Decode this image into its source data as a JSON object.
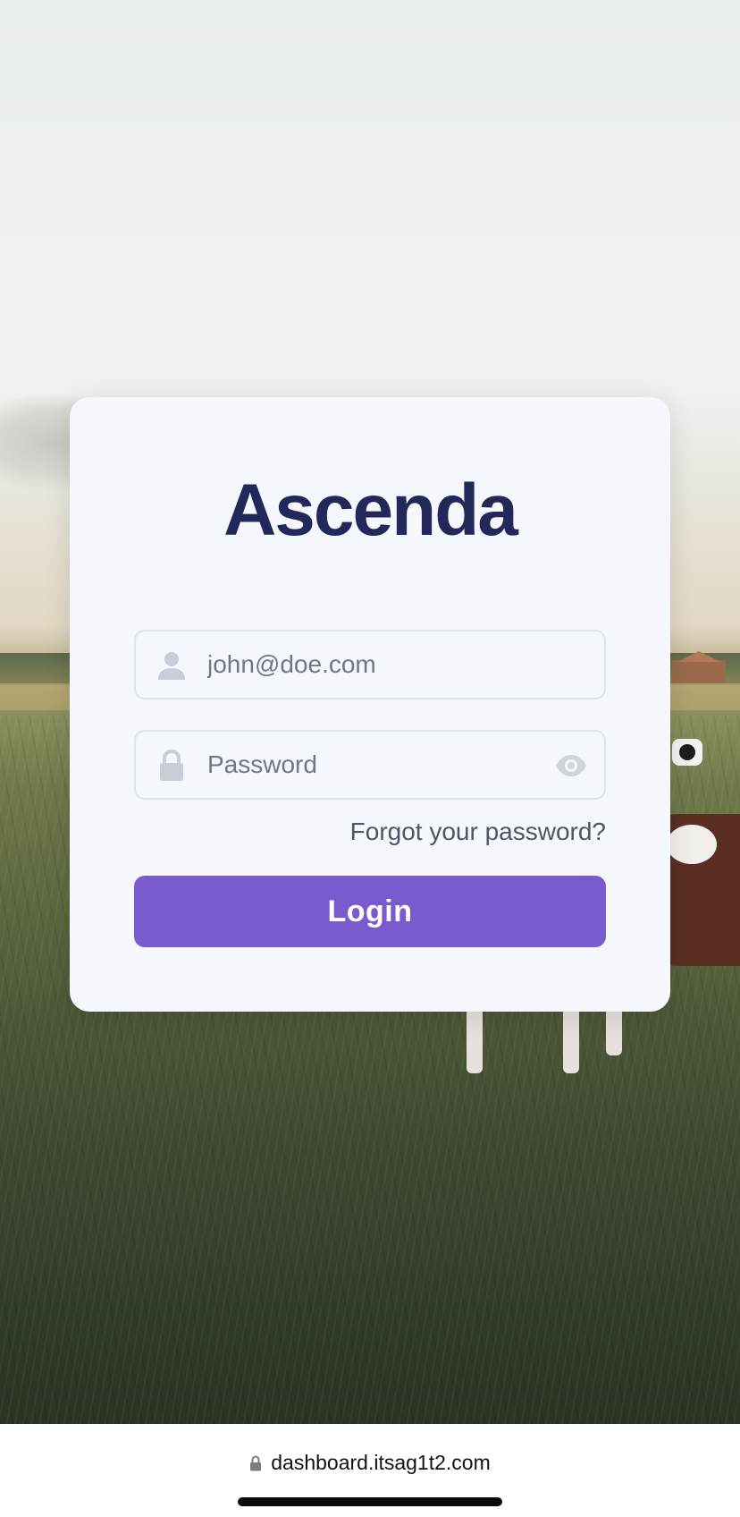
{
  "brand": {
    "logo_text": "Ascenda",
    "logo_color": "#22285a"
  },
  "login_form": {
    "email_placeholder": "john@doe.com",
    "password_placeholder": "Password",
    "forgot_link": "Forgot your password?",
    "login_button": "Login",
    "button_color": "#7a5bcd"
  },
  "icons": {
    "email_field": "user-icon",
    "password_field": "lock-icon",
    "password_toggle": "eye-icon",
    "address_bar": "lock-icon"
  },
  "browser": {
    "url": "dashboard.itsag1t2.com"
  }
}
